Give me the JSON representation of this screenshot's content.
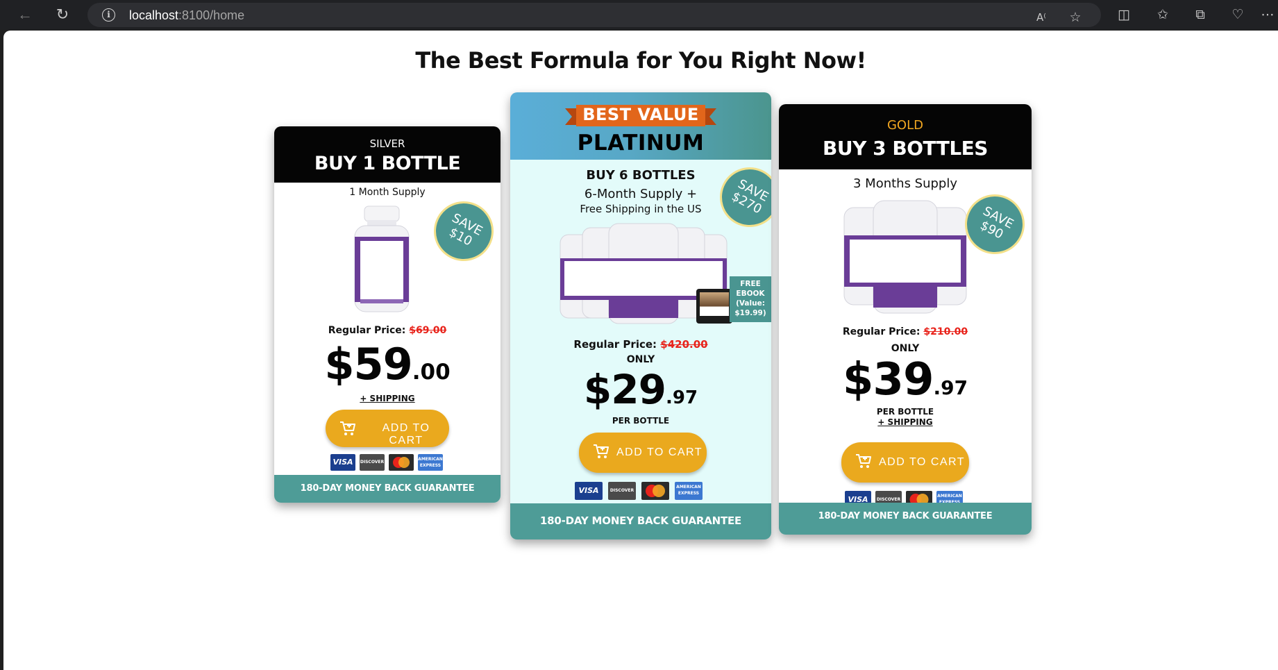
{
  "browser": {
    "url_host": "localhost",
    "url_rest": ":8100/home",
    "icons": [
      "back-arrow-icon",
      "reload-icon",
      "site-info-icon",
      "read-aloud-icon",
      "favorite-star-icon",
      "split-screen-icon",
      "favorites-icon",
      "collections-icon",
      "browser-essentials-icon",
      "more-icon"
    ]
  },
  "page": {
    "headline": "The Best Formula for You Right Now!"
  },
  "colors": {
    "accent_teal": "#4e9c97",
    "button_gold": "#eaa91e",
    "ribbon_orange": "#e2661b",
    "strike_red": "#e8231b",
    "gold_tier": "#f2a721"
  },
  "cards": {
    "silver": {
      "tier": "SILVER",
      "title": "BUY 1 BOTTLE",
      "supply": "1 Month Supply",
      "save_line1": "SAVE",
      "save_line2": "$10",
      "regular_label": "Regular Price:",
      "regular_price": "$69.00",
      "price_dollars": "$59",
      "price_cents": ".00",
      "shipping": "+ SHIPPING",
      "cart_label": "ADD TO CART",
      "guarantee": "180-DAY MONEY BACK GUARANTEE"
    },
    "platinum": {
      "ribbon": "BEST VALUE",
      "title": "PLATINUM",
      "headline": "BUY 6 BOTTLES",
      "supply": "6-Month Supply +",
      "bonus": "Free Shipping in the US",
      "save_line1": "SAVE",
      "save_line2": "$270",
      "ebook_line1": "FREE",
      "ebook_line2": "EBOOK",
      "ebook_line3": "(Value:",
      "ebook_line4": "$19.99)",
      "regular_label": "Regular Price:",
      "regular_price": "$420.00",
      "only": "ONLY",
      "price_dollars": "$29",
      "price_cents": ".97",
      "per_bottle": "PER BOTTLE",
      "cart_label": "ADD TO CART",
      "guarantee": "180-DAY MONEY BACK GUARANTEE"
    },
    "gold": {
      "tier": "GOLD",
      "title": "BUY 3 BOTTLES",
      "supply": "3 Months Supply",
      "save_line1": "SAVE",
      "save_line2": "$90",
      "regular_label": "Regular Price:",
      "regular_price": "$210.00",
      "only": "ONLY",
      "price_dollars": "$39",
      "price_cents": ".97",
      "per_bottle": "PER BOTTLE",
      "shipping": "+ SHIPPING",
      "cart_label": "ADD TO CART",
      "guarantee": "180-DAY MONEY BACK GUARANTEE"
    }
  },
  "payment_methods": {
    "visa": "VISA",
    "discover": "DISCOVER",
    "mastercard": "",
    "amex": "AMERICAN EXPRESS"
  }
}
